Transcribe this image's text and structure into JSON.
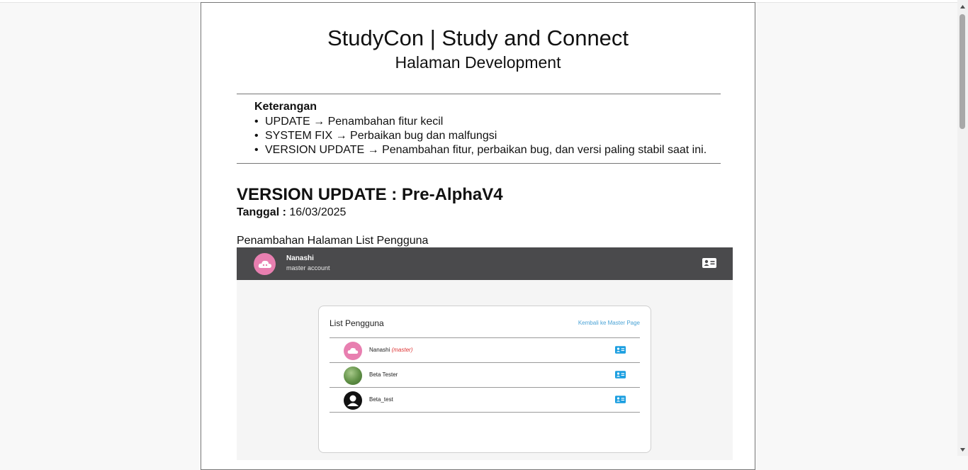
{
  "header": {
    "title": "StudyCon | Study and Connect",
    "subtitle": "Halaman Development"
  },
  "legend": {
    "title": "Keterangan",
    "items": [
      "UPDATE → Penambahan fitur kecil",
      "SYSTEM FIX → Perbaikan bug dan malfungsi",
      "VERSION UPDATE → Penambahan fitur, perbaikan bug, dan versi paling stabil saat ini."
    ]
  },
  "version": {
    "heading": "VERSION UPDATE : Pre-AlphaV4",
    "date_label": "Tanggal :",
    "date_value": "16/03/2025",
    "section_text": "Penambahan Halaman List Pengguna"
  },
  "screenshot": {
    "user_name": "Nanashi",
    "user_role": "master account",
    "card_title": "List Pengguna",
    "back_link": "Kembali ke Master Page",
    "users": [
      {
        "name": "Nanashi",
        "tag": "(master)",
        "avatar": "pink-avatar"
      },
      {
        "name": "Beta Tester",
        "tag": "",
        "avatar": "green-avatar"
      },
      {
        "name": "Beta_test",
        "tag": "",
        "avatar": "default-avatar"
      }
    ]
  },
  "colors": {
    "accent_blue": "#1a9ee0",
    "master_tag_red": "#dd3333",
    "header_bar": "#4a4a4c",
    "avatar_pink": "#e87fb0"
  }
}
